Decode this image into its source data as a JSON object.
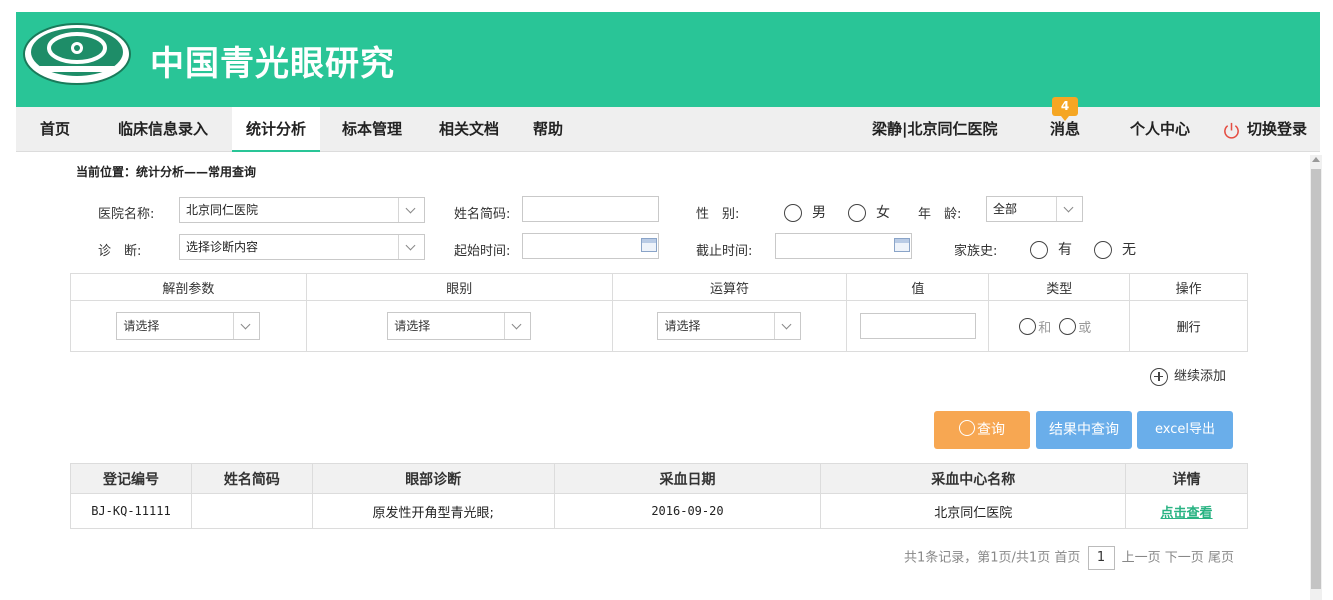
{
  "header": {
    "site_title": "中国青光眼研究",
    "logo_icon": "glaucoma-research-logo"
  },
  "nav": {
    "items": [
      {
        "label": "首页"
      },
      {
        "label": "临床信息录入"
      },
      {
        "label": "统计分析"
      },
      {
        "label": "标本管理"
      },
      {
        "label": "相关文档"
      },
      {
        "label": "帮助"
      }
    ],
    "user": "梁静|北京同仁医院",
    "messages_label": "消息",
    "message_count": "4",
    "profile_label": "个人中心",
    "switch_login_label": "切换登录"
  },
  "breadcrumb": "当前位置：统计分析——常用查询",
  "filters": {
    "hospital_label": "医院名称:",
    "hospital_value": "北京同仁医院",
    "name_code_label": "姓名简码:",
    "name_code_value": "",
    "gender_label": "性　别:",
    "gender_male": "男",
    "gender_female": "女",
    "age_label": "年　龄:",
    "age_value": "全部",
    "diagnosis_label": "诊　断:",
    "diagnosis_value": "选择诊断内容",
    "start_time_label": "起始时间:",
    "start_time_value": "",
    "end_time_label": "截止时间:",
    "end_time_value": "",
    "family_history_label": "家族史:",
    "family_yes": "有",
    "family_no": "无"
  },
  "condition_table": {
    "headers": [
      "解剖参数",
      "眼别",
      "运算符",
      "值",
      "类型",
      "操作"
    ],
    "row": {
      "anatomy_select": "请选择",
      "eye_select": "请选择",
      "operator_select": "请选择",
      "value": "",
      "type_and": "和",
      "type_or": "或",
      "delete_label": "删行"
    },
    "add_more_label": "继续添加"
  },
  "buttons": {
    "query": "查询",
    "query_in_results": "结果中查询",
    "excel_export": "excel导出"
  },
  "results": {
    "headers": [
      "登记编号",
      "姓名简码",
      "眼部诊断",
      "采血日期",
      "采血中心名称",
      "详情"
    ],
    "rows": [
      {
        "reg_no": "BJ-KQ-11111",
        "name_code": "",
        "diagnosis": "原发性开角型青光眼;",
        "date": "2016-09-20",
        "center": "北京同仁医院",
        "detail": "点击查看"
      }
    ]
  },
  "pager": {
    "summary": "共1条记录，第1页/共1页",
    "first": "首页",
    "current_page": "1",
    "prev": "上一页",
    "next": "下一页",
    "last": "尾页"
  },
  "colors": {
    "brand_green": "#29c597",
    "query_orange": "#f7a752",
    "action_blue": "#6aaeea",
    "badge_orange": "#f5a623"
  }
}
